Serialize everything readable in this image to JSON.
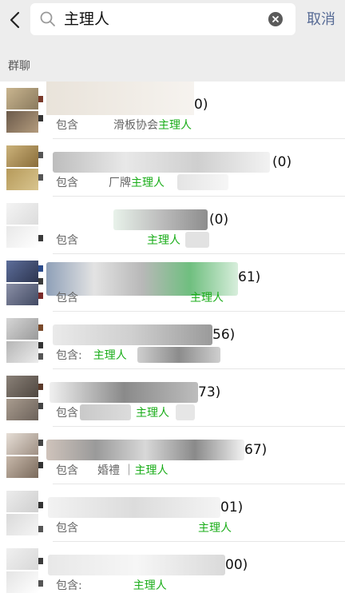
{
  "search": {
    "query": "主理人",
    "cancel_label": "取消"
  },
  "section": {
    "label": "群聊"
  },
  "results": [
    {
      "title_suffix": "0)",
      "sub_prefix": "包含",
      "sub_mid": "滑板协会",
      "sub_highlight": "主理人"
    },
    {
      "title_suffix": "(0)",
      "sub_prefix": "包含",
      "sub_mid": "厂牌",
      "sub_highlight": "主理人"
    },
    {
      "title_suffix": "(0)",
      "sub_prefix": "包含",
      "sub_mid": "",
      "sub_highlight": "主理人"
    },
    {
      "title_suffix": "61)",
      "sub_prefix": "包含",
      "sub_mid": "",
      "sub_highlight": "主理人"
    },
    {
      "title_suffix": "56)",
      "sub_prefix": "包含:",
      "sub_mid": "",
      "sub_highlight": "主理人"
    },
    {
      "title_suffix": "73)",
      "sub_prefix": "包含",
      "sub_mid": "",
      "sub_highlight": "主理人"
    },
    {
      "title_suffix": "67)",
      "sub_prefix": "包含",
      "sub_mid": "婚禮 ｜",
      "sub_highlight": "主理人"
    },
    {
      "title_suffix": "01)",
      "sub_prefix": "包含",
      "sub_mid": "",
      "sub_highlight": "主理人"
    },
    {
      "title_suffix": "00)",
      "sub_prefix": "包含:",
      "sub_mid": "",
      "sub_highlight": "主理人"
    }
  ],
  "colors": {
    "highlight": "#1aad19",
    "link": "#576b95",
    "background": "#ededed"
  }
}
